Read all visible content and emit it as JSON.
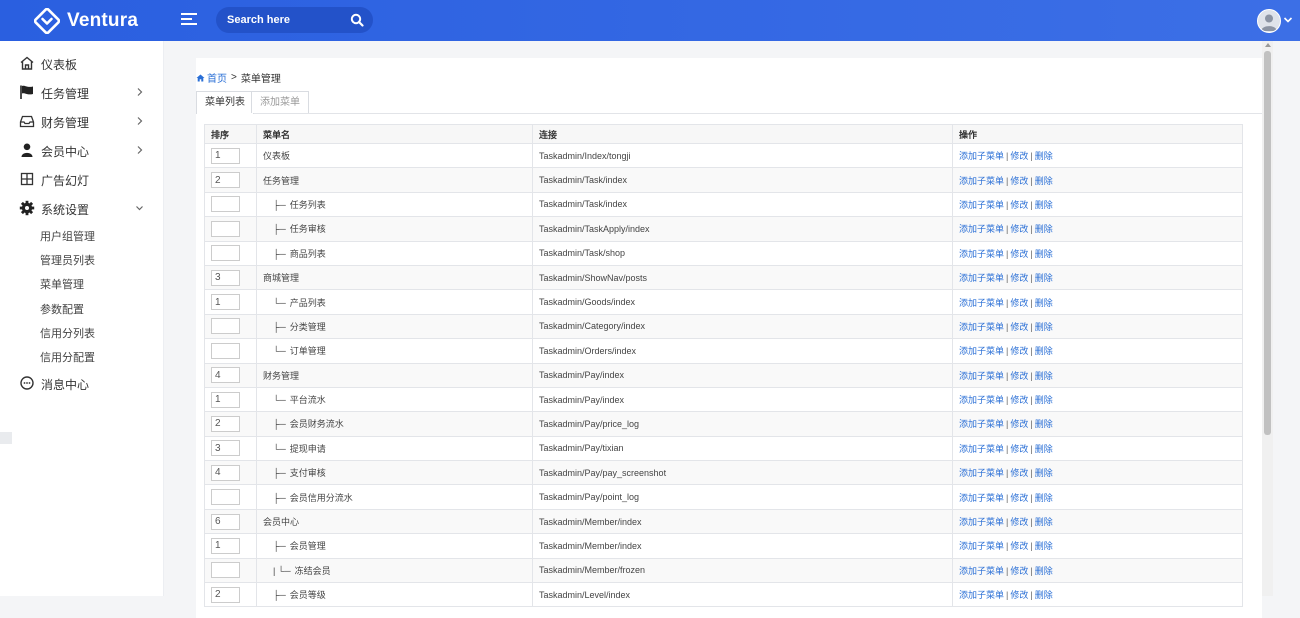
{
  "header": {
    "brand": "Ventura",
    "search_placeholder": "Search here",
    "colors": {
      "topbar": "#2a5fe0",
      "link": "#2a6fd6"
    }
  },
  "sidebar": {
    "items": [
      {
        "label": "仪表板",
        "icon": "home-icon",
        "expandable": false
      },
      {
        "label": "任务管理",
        "icon": "flag-icon",
        "expandable": true
      },
      {
        "label": "财务管理",
        "icon": "inbox-icon",
        "expandable": true
      },
      {
        "label": "会员中心",
        "icon": "user-icon",
        "expandable": true
      },
      {
        "label": "广告幻灯",
        "icon": "grid-icon",
        "expandable": false
      },
      {
        "label": "系统设置",
        "icon": "gear-icon",
        "expandable": true,
        "expanded": true
      },
      {
        "label": "消息中心",
        "icon": "chat-icon",
        "expandable": false
      }
    ],
    "subitems": [
      "用户组管理",
      "管理员列表",
      "菜单管理",
      "参数配置",
      "信用分列表",
      "信用分配置"
    ]
  },
  "breadcrumb": {
    "home": "首页",
    "separator": ">",
    "current": "菜单管理"
  },
  "tabs": [
    {
      "label": "菜单列表",
      "active": true
    },
    {
      "label": "添加菜单",
      "active": false
    }
  ],
  "table": {
    "headers": [
      "排序",
      "菜单名",
      "连接",
      "操作"
    ],
    "actions": [
      "添加子菜单",
      "修改",
      "删除"
    ],
    "action_separator": "|",
    "rows": [
      {
        "sort": "1",
        "name": "仪表板",
        "prefix": "",
        "link": "Taskadmin/Index/tongji"
      },
      {
        "sort": "2",
        "name": "任务管理",
        "prefix": "",
        "link": "Taskadmin/Task/index"
      },
      {
        "sort": "",
        "name": "任务列表",
        "prefix": "├─",
        "link": "Taskadmin/Task/index"
      },
      {
        "sort": "",
        "name": "任务审核",
        "prefix": "├─",
        "link": "Taskadmin/TaskApply/index"
      },
      {
        "sort": "",
        "name": "商品列表",
        "prefix": "├─",
        "link": "Taskadmin/Task/shop"
      },
      {
        "sort": "3",
        "name": "商城管理",
        "prefix": "",
        "link": "Taskadmin/ShowNav/posts"
      },
      {
        "sort": "1",
        "name": "产品列表",
        "prefix": "└─",
        "link": "Taskadmin/Goods/index"
      },
      {
        "sort": "",
        "name": "分类管理",
        "prefix": "├─",
        "link": "Taskadmin/Category/index"
      },
      {
        "sort": "",
        "name": "订单管理",
        "prefix": "└─",
        "link": "Taskadmin/Orders/index"
      },
      {
        "sort": "4",
        "name": "财务管理",
        "prefix": "",
        "link": "Taskadmin/Pay/index"
      },
      {
        "sort": "1",
        "name": "平台流水",
        "prefix": "└─",
        "link": "Taskadmin/Pay/index"
      },
      {
        "sort": "2",
        "name": "会员财务流水",
        "prefix": "├─",
        "link": "Taskadmin/Pay/price_log"
      },
      {
        "sort": "3",
        "name": "提现申请",
        "prefix": "└─",
        "link": "Taskadmin/Pay/tixian"
      },
      {
        "sort": "4",
        "name": "支付审核",
        "prefix": "├─",
        "link": "Taskadmin/Pay/pay_screenshot"
      },
      {
        "sort": "",
        "name": "会员信用分流水",
        "prefix": "├─",
        "link": "Taskadmin/Pay/point_log"
      },
      {
        "sort": "6",
        "name": "会员中心",
        "prefix": "",
        "link": "Taskadmin/Member/index"
      },
      {
        "sort": "1",
        "name": "会员管理",
        "prefix": "├─",
        "link": "Taskadmin/Member/index"
      },
      {
        "sort": "",
        "name": "冻结会员",
        "prefix": "| └─",
        "link": "Taskadmin/Member/frozen"
      },
      {
        "sort": "2",
        "name": "会员等级",
        "prefix": "├─",
        "link": "Taskadmin/Level/index"
      }
    ]
  }
}
